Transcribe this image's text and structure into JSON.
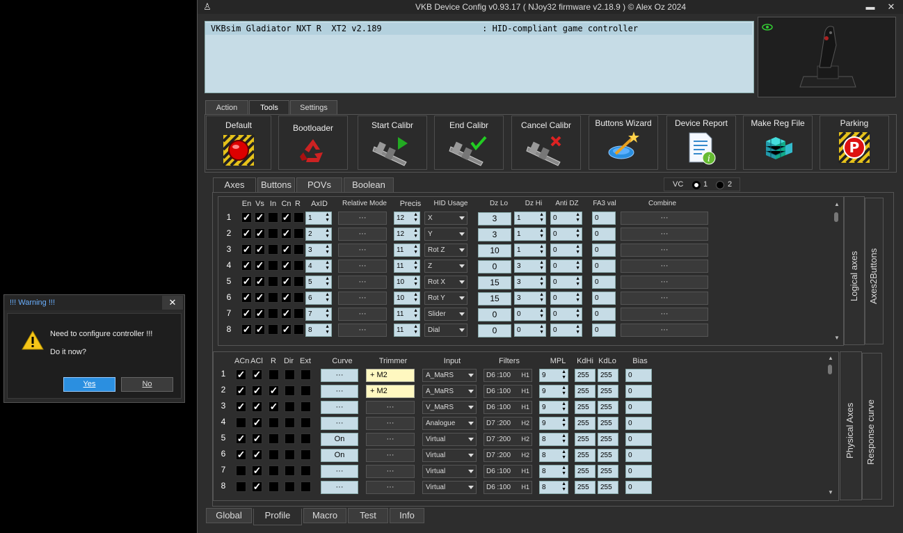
{
  "window": {
    "title": "VKB Device Config v0.93.17 ( NJoy32 firmware v2.18.9 ) © Alex Oz 2024",
    "minimize": "▬",
    "close": "✕"
  },
  "device_list": {
    "row": "VKBsim Gladiator NXT R  XT2 v2.189                    : HID-compliant game controller"
  },
  "top_tabs": [
    "Action",
    "Tools",
    "Settings"
  ],
  "tools": [
    "Default",
    "Bootloader",
    "Start Calibr",
    "End Calibr",
    "Cancel Calibr",
    "Buttons Wizard",
    "Device Report",
    "Make Reg File",
    "Parking"
  ],
  "sub_tabs": [
    "Axes",
    "Buttons",
    "POVs",
    "Boolean"
  ],
  "vc": {
    "label": "VC",
    "opt1": "1",
    "opt2": "2"
  },
  "logical": {
    "headers": {
      "en": "En",
      "vs": "Vs",
      "in": "In",
      "cn": "Cn",
      "r": "R",
      "axid": "AxID",
      "relmode": "Relative Mode",
      "precis": "Precis",
      "hid": "HID Usage",
      "dzlo": "Dz Lo",
      "dzhi": "Dz Hi",
      "antidz": "Anti DZ",
      "fa3": "FA3 val",
      "combine": "Combine"
    },
    "rows": [
      {
        "n": "1",
        "en": true,
        "vs": true,
        "in": false,
        "cn": true,
        "r": false,
        "axid": "1",
        "precis": "12",
        "hid": "X",
        "dzlo": "3",
        "dzhi": "1",
        "antidz": "0",
        "fa3": "0"
      },
      {
        "n": "2",
        "en": true,
        "vs": true,
        "in": false,
        "cn": true,
        "r": false,
        "axid": "2",
        "precis": "12",
        "hid": "Y",
        "dzlo": "3",
        "dzhi": "1",
        "antidz": "0",
        "fa3": "0"
      },
      {
        "n": "3",
        "en": true,
        "vs": true,
        "in": false,
        "cn": true,
        "r": false,
        "axid": "3",
        "precis": "11",
        "hid": "Rot Z",
        "dzlo": "10",
        "dzhi": "1",
        "antidz": "0",
        "fa3": "0"
      },
      {
        "n": "4",
        "en": true,
        "vs": true,
        "in": false,
        "cn": true,
        "r": false,
        "axid": "4",
        "precis": "11",
        "hid": "Z",
        "dzlo": "0",
        "dzhi": "3",
        "antidz": "0",
        "fa3": "0"
      },
      {
        "n": "5",
        "en": true,
        "vs": true,
        "in": false,
        "cn": true,
        "r": false,
        "axid": "5",
        "precis": "10",
        "hid": "Rot X",
        "dzlo": "15",
        "dzhi": "3",
        "antidz": "0",
        "fa3": "0"
      },
      {
        "n": "6",
        "en": true,
        "vs": true,
        "in": false,
        "cn": true,
        "r": false,
        "axid": "6",
        "precis": "10",
        "hid": "Rot Y",
        "dzlo": "15",
        "dzhi": "3",
        "antidz": "0",
        "fa3": "0"
      },
      {
        "n": "7",
        "en": true,
        "vs": true,
        "in": false,
        "cn": true,
        "r": false,
        "axid": "7",
        "precis": "11",
        "hid": "Slider",
        "dzlo": "0",
        "dzhi": "0",
        "antidz": "0",
        "fa3": "0"
      },
      {
        "n": "8",
        "en": true,
        "vs": true,
        "in": false,
        "cn": true,
        "r": false,
        "axid": "8",
        "precis": "11",
        "hid": "Dial",
        "dzlo": "0",
        "dzhi": "0",
        "antidz": "0",
        "fa3": "0"
      }
    ],
    "side_tabs": [
      "Logical axes",
      "Axes2Buttons"
    ]
  },
  "physical": {
    "headers": {
      "acn": "ACn",
      "acl": "ACl",
      "r": "R",
      "dir": "Dir",
      "ext": "Ext",
      "curve": "Curve",
      "trimmer": "Trimmer",
      "input": "Input",
      "filters": "Filters",
      "mpl": "MPL",
      "kdhi": "KdHi",
      "kdlo": "KdLo",
      "bias": "Bias"
    },
    "rows": [
      {
        "n": "1",
        "acn": true,
        "acl": true,
        "r": false,
        "dir": false,
        "ext": false,
        "curve": "···",
        "trim": "+   M2",
        "trimSet": true,
        "input": "A_MaRS",
        "filt": "D6 :100",
        "h": "H1",
        "mpl": "9",
        "kdhi": "255",
        "kdlo": "255",
        "bias": "0"
      },
      {
        "n": "2",
        "acn": true,
        "acl": true,
        "r": true,
        "dir": false,
        "ext": false,
        "curve": "···",
        "trim": "+   M2",
        "trimSet": true,
        "input": "A_MaRS",
        "filt": "D6 :100",
        "h": "H1",
        "mpl": "9",
        "kdhi": "255",
        "kdlo": "255",
        "bias": "0"
      },
      {
        "n": "3",
        "acn": true,
        "acl": true,
        "r": true,
        "dir": false,
        "ext": false,
        "curve": "···",
        "trim": "···",
        "trimSet": false,
        "input": "V_MaRS",
        "filt": "D6 :100",
        "h": "H1",
        "mpl": "9",
        "kdhi": "255",
        "kdlo": "255",
        "bias": "0"
      },
      {
        "n": "4",
        "acn": false,
        "acl": true,
        "r": false,
        "dir": false,
        "ext": false,
        "curve": "···",
        "trim": "···",
        "trimSet": false,
        "input": "Analogue",
        "filt": "D7 :200",
        "h": "H2",
        "mpl": "9",
        "kdhi": "255",
        "kdlo": "255",
        "bias": "0"
      },
      {
        "n": "5",
        "acn": true,
        "acl": true,
        "r": false,
        "dir": false,
        "ext": false,
        "curve": "On",
        "trim": "···",
        "trimSet": false,
        "input": "Virtual",
        "filt": "D7 :200",
        "h": "H2",
        "mpl": "8",
        "kdhi": "255",
        "kdlo": "255",
        "bias": "0"
      },
      {
        "n": "6",
        "acn": true,
        "acl": true,
        "r": false,
        "dir": false,
        "ext": false,
        "curve": "On",
        "trim": "···",
        "trimSet": false,
        "input": "Virtual",
        "filt": "D7 :200",
        "h": "H2",
        "mpl": "8",
        "kdhi": "255",
        "kdlo": "255",
        "bias": "0"
      },
      {
        "n": "7",
        "acn": false,
        "acl": true,
        "r": false,
        "dir": false,
        "ext": false,
        "curve": "···",
        "trim": "···",
        "trimSet": false,
        "input": "Virtual",
        "filt": "D6 :100",
        "h": "H1",
        "mpl": "8",
        "kdhi": "255",
        "kdlo": "255",
        "bias": "0"
      },
      {
        "n": "8",
        "acn": false,
        "acl": true,
        "r": false,
        "dir": false,
        "ext": false,
        "curve": "···",
        "trim": "···",
        "trimSet": false,
        "input": "Virtual",
        "filt": "D6 :100",
        "h": "H1",
        "mpl": "8",
        "kdhi": "255",
        "kdlo": "255",
        "bias": "0"
      }
    ],
    "side_tabs": [
      "Physical Axes",
      "Response curve"
    ]
  },
  "bottom_tabs": [
    "Global",
    "Profile",
    "Macro",
    "Test",
    "Info"
  ],
  "dialog": {
    "title": "!!! Warning !!!",
    "close": "✕",
    "line1": "Need to configure controller !!!",
    "line2": "Do it now?",
    "yes": "Yes",
    "no": "No"
  },
  "glyphs": {
    "ellipsis": "···",
    "check": "✓"
  },
  "colors": {
    "field": "#c6dce6",
    "accent": "#2b8fe0",
    "trim": "#fff8c0"
  }
}
